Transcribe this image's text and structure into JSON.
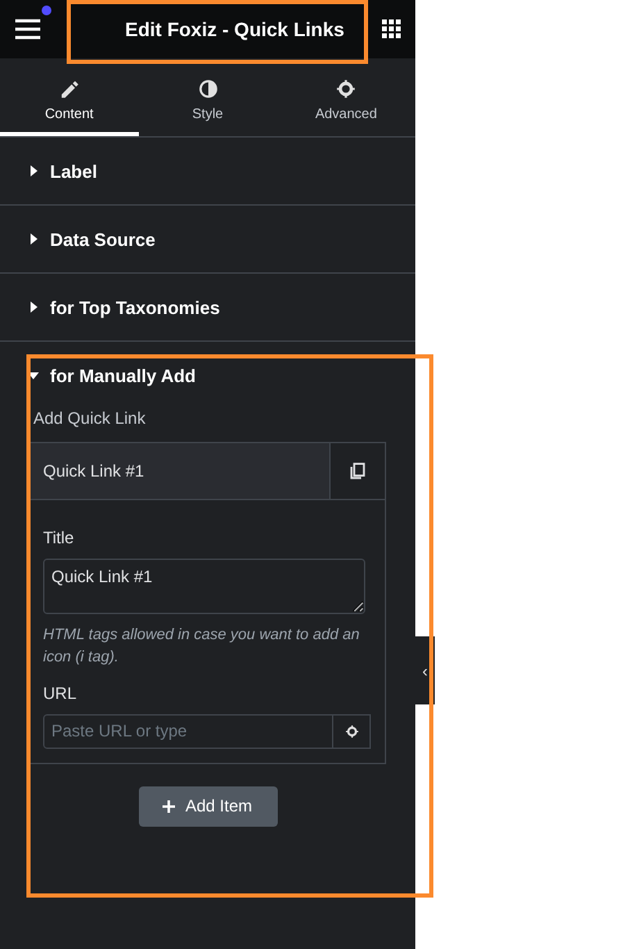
{
  "header": {
    "title": "Edit Foxiz - Quick Links",
    "notification": true
  },
  "tabs": [
    {
      "label": "Content",
      "selected": true,
      "kind": "pencil"
    },
    {
      "label": "Style",
      "selected": false,
      "kind": "contrast"
    },
    {
      "label": "Advanced",
      "selected": false,
      "kind": "gear"
    }
  ],
  "sections": [
    {
      "title": "Label",
      "expanded": false
    },
    {
      "title": "Data Source",
      "expanded": false
    },
    {
      "title": "for Top Taxonomies",
      "expanded": false
    },
    {
      "title": "for Manually Add",
      "expanded": true
    }
  ],
  "repeater": {
    "label": "Add Quick Link",
    "items": [
      {
        "title": "Quick Link #1",
        "fields": [
          {
            "kind": "textarea",
            "label": "Title",
            "value": "Quick Link #1",
            "help": "HTML tags allowed in case you want to add an icon (i tag)."
          },
          {
            "kind": "url",
            "label": "URL",
            "placeholder": "Paste URL or type"
          }
        ]
      }
    ],
    "add_button": "Add Item"
  },
  "collapse_handle": "‹"
}
